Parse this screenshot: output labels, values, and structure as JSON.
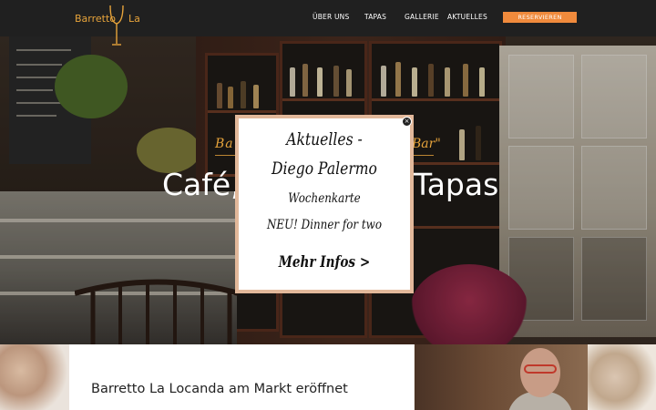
{
  "brand": {
    "left": "Barretto",
    "right": "La",
    "color": "#e6a33b"
  },
  "nav": {
    "items": [
      "ÜBER UNS",
      "TAPAS",
      "GALLERIE",
      "AKTUELLES"
    ],
    "reserve_label": "RESERVIEREN",
    "reserve_color": "#f08a3c"
  },
  "hero": {
    "subtitle_left": "Ba",
    "subtitle_right": "Bar\"",
    "title_left": "Café,",
    "title_right": "Tapas"
  },
  "popup": {
    "title": "Aktuelles -",
    "subtitle": "Diego Palermo",
    "line1": "Wochenkarte",
    "line2": "NEU! Dinner for two",
    "link": "Mehr Infos >",
    "close_icon": "close-icon",
    "border_color": "#e2b89a"
  },
  "bottom": {
    "heading": "Barretto La Locanda am Markt eröffnet"
  }
}
